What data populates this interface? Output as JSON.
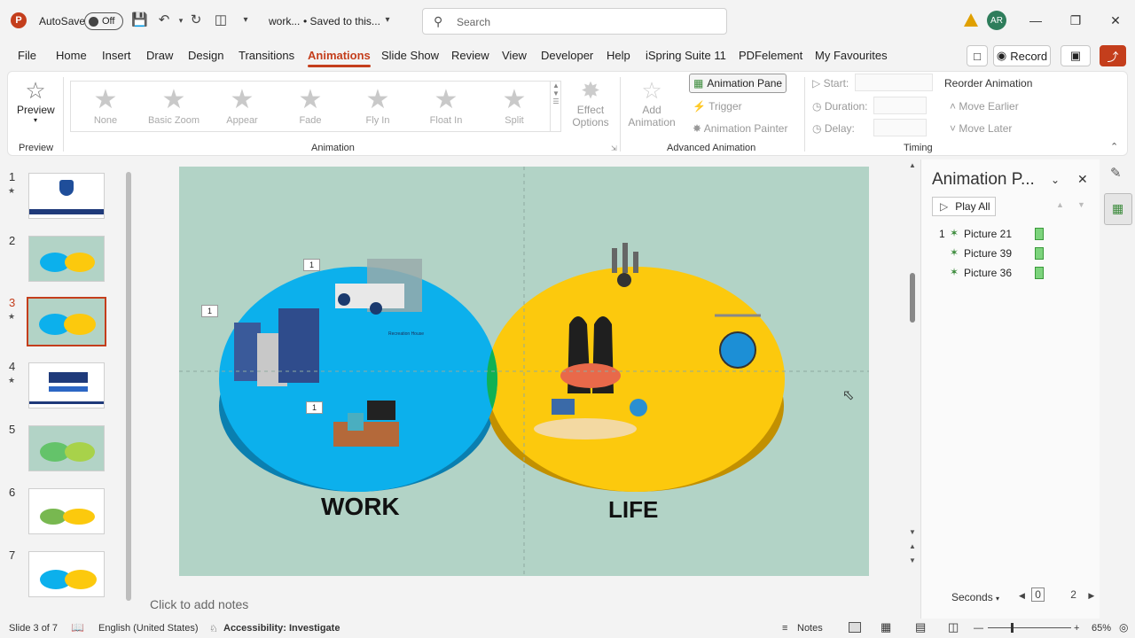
{
  "titlebar": {
    "app_icon": "P",
    "autosave_label": "AutoSave",
    "autosave_state": "Off",
    "doc_name": "work...",
    "doc_status": "• Saved to this...",
    "search_placeholder": "Search",
    "avatar_initials": "AR"
  },
  "menu": {
    "items": [
      "File",
      "Home",
      "Insert",
      "Draw",
      "Design",
      "Transitions",
      "Animations",
      "Slide Show",
      "Review",
      "View",
      "Developer",
      "Help",
      "iSpring Suite 11",
      "PDFelement",
      "My Favourites"
    ],
    "active": "Animations",
    "record_label": "Record"
  },
  "ribbon": {
    "preview_label": "Preview",
    "preview_group": "Preview",
    "animation_group": "Animation",
    "animations": [
      "None",
      "Basic Zoom",
      "Appear",
      "Fade",
      "Fly In",
      "Float In",
      "Split"
    ],
    "effect_options_line1": "Effect",
    "effect_options_line2": "Options",
    "add_animation_line1": "Add",
    "add_animation_line2": "Animation",
    "animation_pane": "Animation Pane",
    "trigger": "Trigger",
    "animation_painter": "Animation Painter",
    "advanced_group": "Advanced Animation",
    "start": "Start:",
    "duration": "Duration:",
    "delay": "Delay:",
    "reorder": "Reorder Animation",
    "move_earlier": "Move Earlier",
    "move_later": "Move Later",
    "timing_group": "Timing"
  },
  "slides": {
    "numbers": [
      "1",
      "2",
      "3",
      "4",
      "5",
      "6",
      "7"
    ],
    "active_index": 2
  },
  "slide": {
    "work_label": "WORK",
    "life_label": "LIFE",
    "anim_tags": [
      "1",
      "1",
      "1"
    ],
    "sign_text": "Recreation House"
  },
  "notes": {
    "placeholder": "Click to add notes"
  },
  "animation_pane": {
    "title": "Animation P...",
    "play_all": "Play All",
    "items": [
      {
        "num": "1",
        "name": "Picture 21"
      },
      {
        "num": "",
        "name": "Picture 39"
      },
      {
        "num": "",
        "name": "Picture 36"
      }
    ],
    "seconds_label": "Seconds",
    "timeline_start": "0",
    "timeline_end": "2"
  },
  "status": {
    "slide_info": "Slide 3 of 7",
    "language": "English (United States)",
    "accessibility": "Accessibility: Investigate",
    "notes": "Notes",
    "zoom": "65%"
  },
  "colors": {
    "accent": "#c43e1c",
    "slide_bg": "#b2d3c6",
    "work_blue": "#0cb0ec",
    "life_yellow": "#fcc90d",
    "overlap_green": "#10b154"
  }
}
